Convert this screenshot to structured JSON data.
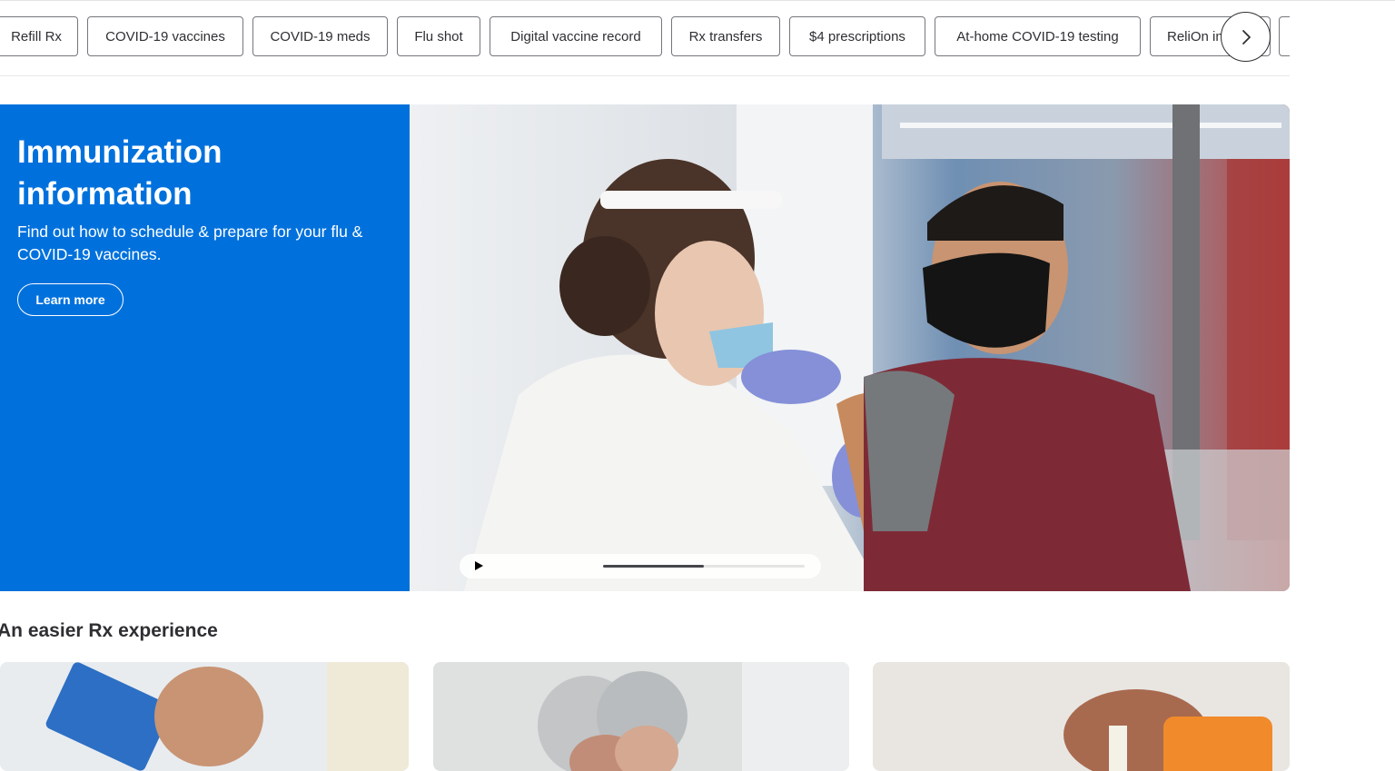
{
  "pill_nav": {
    "items": [
      "Refill Rx",
      "COVID-19 vaccines",
      "COVID-19 meds",
      "Flu shot",
      "Digital vaccine record",
      "Rx transfers",
      "$4 prescriptions",
      "At-home COVID-19 testing",
      "ReliOn in"
    ],
    "next_icon": "chevron-right-icon"
  },
  "hero": {
    "title": "Immunization information",
    "subtitle": "Find out how to schedule & prepare for your flu & COVID-19 vaccines.",
    "cta_label": "Learn more",
    "bg_color": "#0071dc",
    "video_progress": 0.5
  },
  "section": {
    "title": "An easier Rx experience"
  }
}
